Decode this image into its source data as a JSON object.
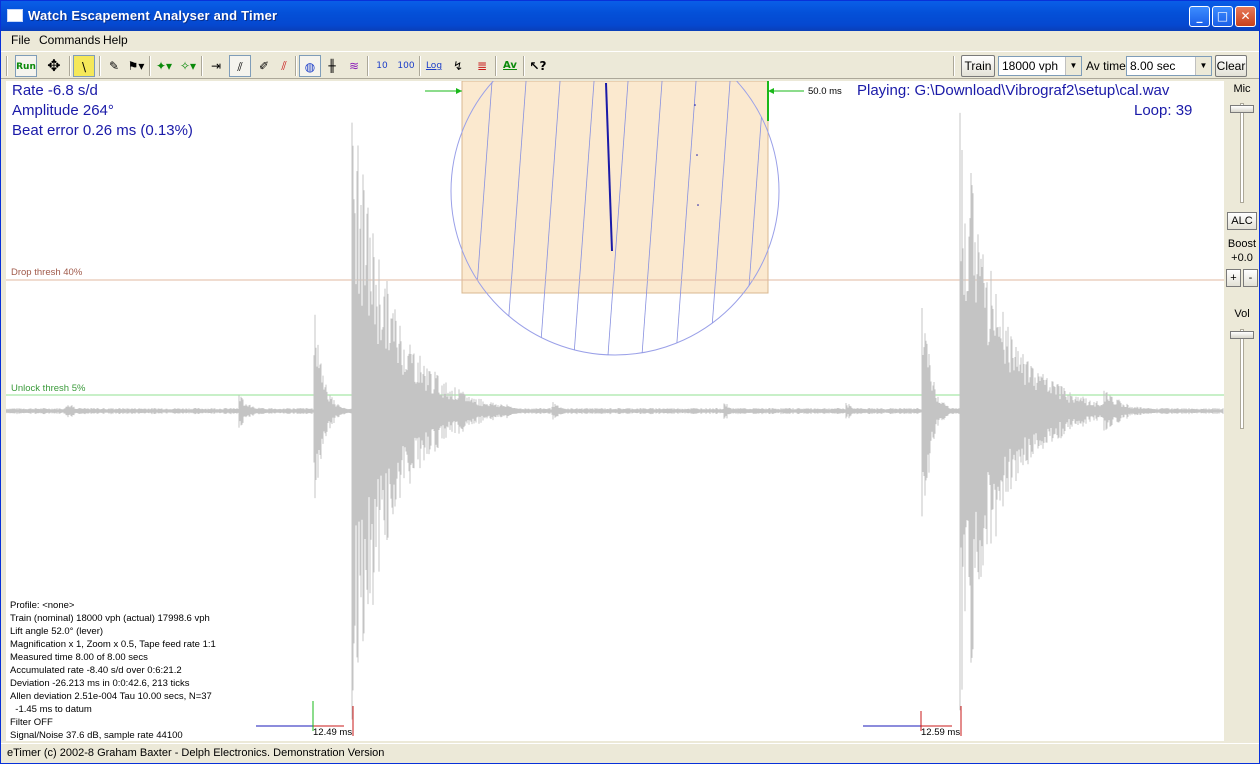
{
  "window": {
    "title": "Watch Escapement Analyser and Timer"
  },
  "menu": {
    "file": "File",
    "commands": "Commands",
    "help": "Help"
  },
  "toolbar": {
    "run": "Run",
    "scale_10": "10",
    "scale_100": "100",
    "log": "Log",
    "av": "Av",
    "train_button": "Train",
    "train_rate": "18000 vph",
    "av_time_label": "Av time",
    "av_time_value": "8.00 sec",
    "clear_button": "Clear"
  },
  "readouts": {
    "rate": "Rate   -6.8 s/d",
    "amplitude": "Amplitude 264°",
    "beat_error": "Beat error 0.26 ms (0.13%)",
    "playing": "Playing:  G:\\Download\\Vibrograf2\\setup\\cal.wav",
    "loop": "Loop:  39",
    "scale_ms": "50.0 ms",
    "drop_thresh": "Drop thresh 40%",
    "unlock_thresh": "Unlock thresh 5%",
    "tick_left": "12.49 ms",
    "tick_right": "12.59 ms"
  },
  "info_lines": [
    "Profile: <none>",
    "Train (nominal) 18000 vph (actual) 17998.6 vph",
    "Lift angle  52.0° (lever)",
    "Magnification x 1, Zoom x 0.5, Tape feed rate 1:1",
    "Measured time 8.00 of 8.00 secs",
    "Accumulated rate -8.40 s/d over 0:6:21.2",
    "Deviation -26.213 ms in 0:0:42.6, 213 ticks",
    "Allen deviation 2.51e-004 Tau 10.00 secs, N=37",
    "  -1.45 ms to datum",
    "Filter OFF",
    "Signal/Noise 37.6 dB, sample rate 44100"
  ],
  "side": {
    "mic": "Mic",
    "alc": "ALC",
    "boost": "Boost",
    "boost_value": "+0.0",
    "plus": "+",
    "minus": "-",
    "vol": "Vol"
  },
  "status": "eTimer (c) 2002-8 Graham Baxter - Delph Electronics. Demonstration Version",
  "colors": {
    "title_blue": "#0450d8",
    "waveform": "#c8c8c8",
    "paper": "#fbe9cf",
    "trace": "#1a1aa8",
    "drop_line": "#e0b8a0",
    "unlock_line": "#90e090"
  }
}
